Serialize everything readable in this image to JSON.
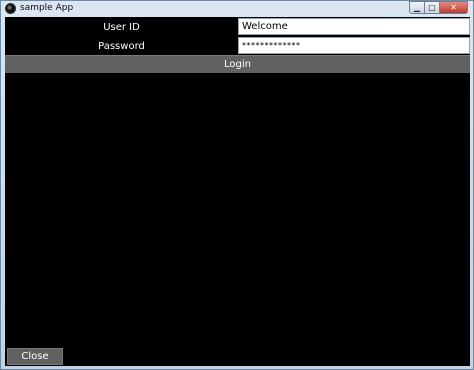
{
  "window": {
    "title": "sample App",
    "app_icon": "app-icon"
  },
  "form": {
    "user_id_label": "User ID",
    "user_id_value": "Welcome",
    "password_label": "Password",
    "password_value": "*************"
  },
  "buttons": {
    "login_label": "Login",
    "close_label": "Close"
  },
  "colors": {
    "background": "#000000",
    "button": "#616161",
    "text": "#ffffff"
  }
}
